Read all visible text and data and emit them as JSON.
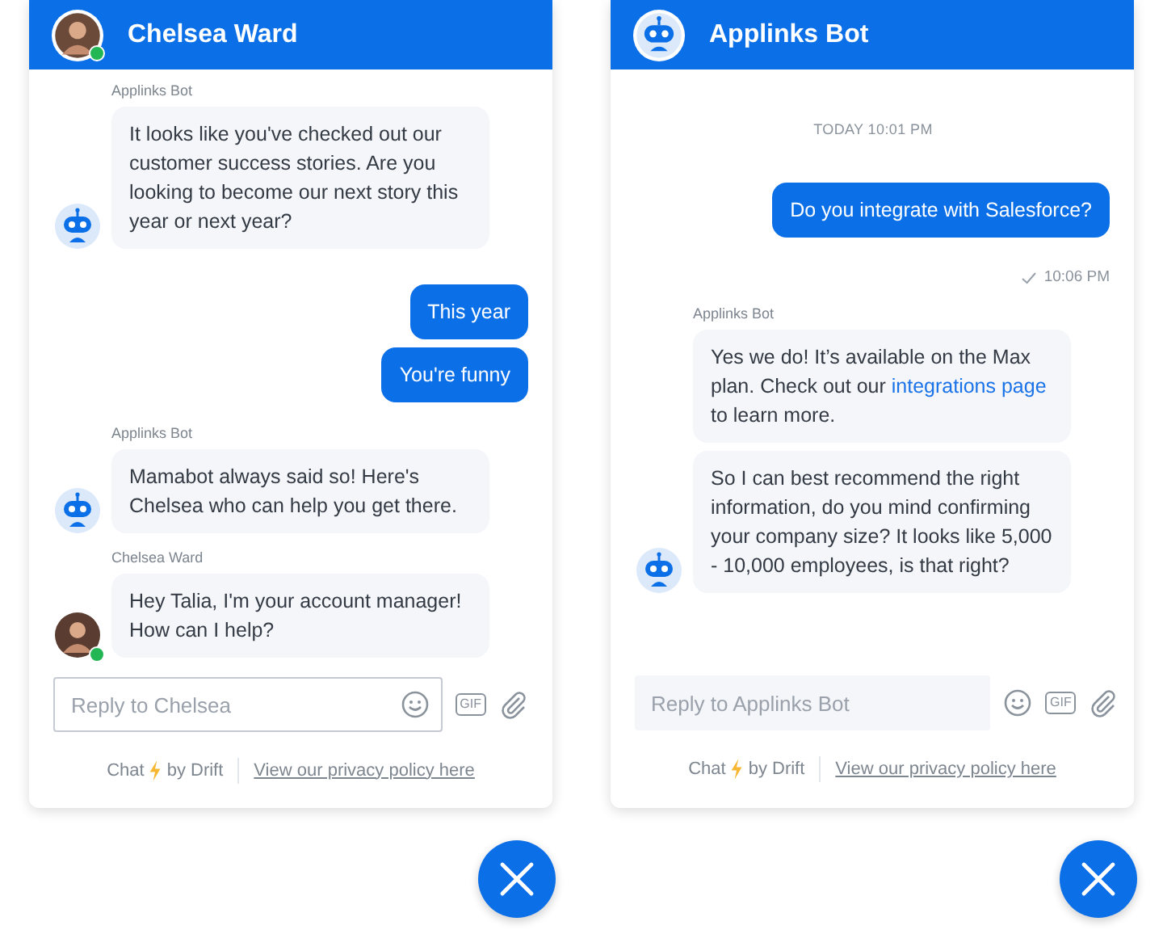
{
  "panels": [
    {
      "header": {
        "title": "Chelsea Ward",
        "avatar": {
          "kind": "person"
        },
        "online": true
      },
      "messages": [
        {
          "kind": "group",
          "sender": "Applinks Bot",
          "avatar": {
            "kind": "bot"
          },
          "bubbles": [
            {
              "text": "It looks like you've checked out our customer success stories. Are you looking to become our next story this year or next year?"
            }
          ]
        },
        {
          "kind": "outgoing",
          "bubbles": [
            {
              "text": "This year"
            },
            {
              "text": "You're funny"
            }
          ]
        },
        {
          "kind": "group",
          "sender": "Applinks Bot",
          "avatar": {
            "kind": "bot"
          },
          "bubbles": [
            {
              "text": "Mamabot always said so! Here's Chelsea who can help you get there."
            }
          ]
        },
        {
          "kind": "group",
          "sender": "Chelsea Ward",
          "avatar": {
            "kind": "person"
          },
          "online": true,
          "bubbles": [
            {
              "text": "Hey Talia, I'm your account manager! How can I help?"
            }
          ]
        }
      ],
      "composer": {
        "placeholder": "Reply to Chelsea",
        "focused": true,
        "gif": "GIF"
      },
      "footer": {
        "chat": "Chat",
        "by": "by Drift",
        "privacy_link": "View our privacy policy here"
      }
    },
    {
      "header": {
        "title": "Applinks Bot",
        "avatar": {
          "kind": "bot"
        }
      },
      "messages": [
        {
          "kind": "time",
          "text": "TODAY 10:01 PM"
        },
        {
          "kind": "outgoing",
          "bubbles": [
            {
              "text": "Do you integrate with Salesforce?"
            }
          ]
        },
        {
          "kind": "receipt",
          "text": "10:06 PM"
        },
        {
          "kind": "group",
          "sender": "Applinks Bot",
          "avatar": {
            "kind": "bot"
          },
          "bubbles": [
            {
              "text": "Yes we do! It’s available on the Max plan. Check out our ",
              "link": "integrations page",
              "after": " to learn more."
            },
            {
              "text": "So I can best recommend the right information, do you mind confirming your company size? It looks like 5,000 - 10,000 employees, is that right?"
            }
          ]
        }
      ],
      "composer": {
        "placeholder": "Reply to Applinks Bot",
        "focused": false,
        "gif": "GIF"
      },
      "footer": {
        "chat": "Chat",
        "by": "by Drift",
        "privacy_link": "View our privacy policy here"
      }
    }
  ]
}
